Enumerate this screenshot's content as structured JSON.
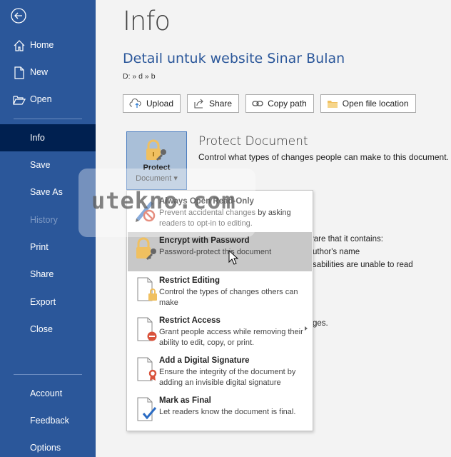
{
  "sidebar": {
    "items": [
      {
        "label": "Home",
        "icon": "home-icon"
      },
      {
        "label": "New",
        "icon": "new-document-icon"
      },
      {
        "label": "Open",
        "icon": "folder-open-icon"
      },
      {
        "label": "Info",
        "active": true
      },
      {
        "label": "Save"
      },
      {
        "label": "Save As"
      },
      {
        "label": "History",
        "disabled": true
      },
      {
        "label": "Print"
      },
      {
        "label": "Share"
      },
      {
        "label": "Export"
      },
      {
        "label": "Close"
      },
      {
        "label": "Account"
      },
      {
        "label": "Feedback"
      },
      {
        "label": "Options"
      }
    ]
  },
  "main": {
    "title": "Info",
    "doc_title": "Detail untuk website Sinar Bulan",
    "doc_path": "D: » d » b",
    "buttons": {
      "upload": "Upload",
      "share": "Share",
      "copy_path": "Copy path",
      "open_location": "Open file location"
    },
    "protect": {
      "button_line1": "Protect",
      "button_line2": "Document ▾",
      "heading": "Protect Document",
      "description": "Control what types of changes people can make to this document."
    },
    "background_fragments": {
      "inspect_line1": "vare that it contains:",
      "inspect_line2": "uthor's name",
      "inspect_line3": "sabilities are unable to read",
      "versions_line": "ges."
    }
  },
  "menu": {
    "items": [
      {
        "title": "Always Open Read-Only",
        "description": "Prevent accidental changes by asking readers to opt-in to editing."
      },
      {
        "title": "Encrypt with Password",
        "description": "Password-protect this document",
        "highlighted": true
      },
      {
        "title": "Restrict Editing",
        "description": "Control the types of changes others can make"
      },
      {
        "title": "Restrict Access",
        "description": "Grant people access while removing their ability to edit, copy, or print.",
        "has_submenu": true
      },
      {
        "title": "Add a Digital Signature",
        "description": "Ensure the integrity of the document by adding an invisible digital signature"
      },
      {
        "title": "Mark as Final",
        "description": "Let readers know the document is final."
      }
    ]
  },
  "watermark": "utekno.com",
  "colors": {
    "sidebar": "#2b579a",
    "sidebar_active": "#002050",
    "accent_link": "#2b579a",
    "menu_hover": "#c8c8c8",
    "lock_gold": "#f0c060"
  }
}
